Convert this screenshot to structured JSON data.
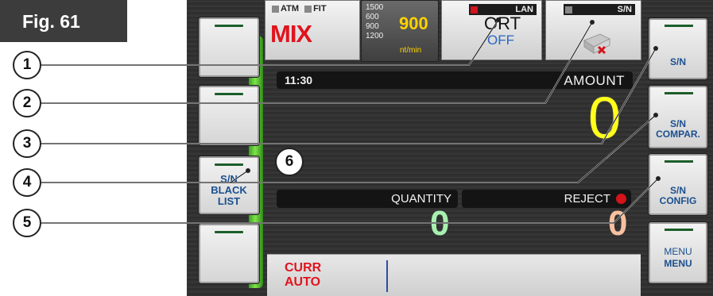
{
  "figure": {
    "label": "Fig. 61"
  },
  "top": {
    "atm": "ATM",
    "fit": "FIT",
    "mode": "MIX",
    "speeds": [
      "1500",
      "600",
      "900",
      "1200"
    ],
    "speed_value": "900",
    "speed_unit": "nt/min",
    "lan": "LAN",
    "sort_label": "ORT",
    "sort_state": "OFF",
    "sn_status": "S/N"
  },
  "display": {
    "time": "11:30",
    "amount_label": "AMOUNT",
    "amount_value": "0",
    "quantity_label": "QUANTITY",
    "quantity_value": "0",
    "reject_label": "REJECT",
    "reject_value": "0",
    "currency_line1": "CURR",
    "currency_line2": "AUTO"
  },
  "left_buttons": [
    {
      "line1": "",
      "line2": "",
      "line3": ""
    },
    {
      "line1": "",
      "line2": "",
      "line3": ""
    },
    {
      "line1": "S/N",
      "line2": "BLACK",
      "line3": "LIST"
    },
    {
      "line1": "",
      "line2": "",
      "line3": ""
    }
  ],
  "right_buttons": [
    {
      "line1": "S/N",
      "line2": ""
    },
    {
      "line1": "S/N",
      "line2": "COMPAR."
    },
    {
      "line1": "S/N",
      "line2": "CONFIG"
    },
    {
      "line1": "MENU",
      "line2": "MENU"
    }
  ],
  "callouts": [
    "1",
    "2",
    "3",
    "4",
    "5",
    "6"
  ],
  "colors": {
    "mix_red": "#e0141e",
    "speed_yellow": "#ffd200",
    "amount_yellow": "#ffff1a",
    "quantity_green": "#a8f0b0",
    "reject_peach": "#f7c0a0",
    "sort_blue": "#2a66c4",
    "led_red": "#d4131a"
  },
  "icons": [
    "printer-error-icon",
    "led-indicator-icon"
  ]
}
